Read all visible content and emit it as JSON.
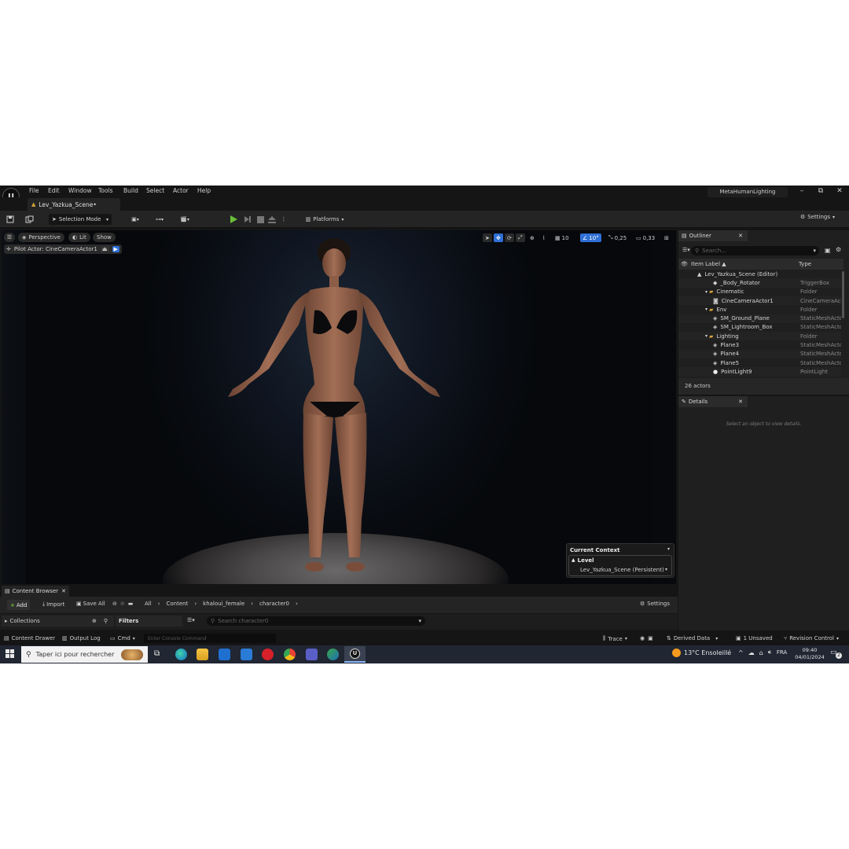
{
  "menu": {
    "logo": "U",
    "items": [
      "File",
      "Edit",
      "Window",
      "Tools",
      "Build",
      "Select",
      "Actor",
      "Help"
    ],
    "project": "MetaHumanLighting"
  },
  "window_controls": {
    "minimize": "–",
    "restore": "⧉",
    "close": "✕"
  },
  "level_tab": {
    "label": "Lev_Yazkua_Scene•"
  },
  "toolbar": {
    "selection_mode": "Selection Mode",
    "platforms": "Platforms",
    "settings": "Settings",
    "colors": {
      "play": "#6abf3a"
    }
  },
  "viewport": {
    "perspective": "Perspective",
    "lit": "Lit",
    "show": "Show",
    "pilot_actor": "Pilot Actor: CineCameraActor1",
    "grid_snap": "10",
    "angle_snap": "10°",
    "scale_snap": "0,25",
    "camera_speed": "0,33",
    "context": {
      "title": "Current Context",
      "level_label": "Level",
      "level_value": "Lev_Yazkua_Scene (Persistent)"
    }
  },
  "outliner": {
    "tab": "Outliner",
    "search_placeholder": "Search...",
    "col_label": "Item Label ▲",
    "col_type": "Type",
    "rows": [
      {
        "label": "Lev_Yazkua_Scene (Editor)",
        "type": "",
        "indent": 0,
        "kind": "level"
      },
      {
        "label": "_Body_Rotator",
        "type": "TriggerBox",
        "indent": 2,
        "kind": "actor"
      },
      {
        "label": "Cinematic",
        "type": "Folder",
        "indent": 1,
        "kind": "folder"
      },
      {
        "label": "CineCameraActor1",
        "type": "CineCameraActor",
        "indent": 2,
        "kind": "camera"
      },
      {
        "label": "Env",
        "type": "Folder",
        "indent": 1,
        "kind": "folder"
      },
      {
        "label": "SM_Ground_Plane",
        "type": "StaticMeshActor",
        "indent": 2,
        "kind": "mesh"
      },
      {
        "label": "SM_Lightroom_Box",
        "type": "StaticMeshActor",
        "indent": 2,
        "kind": "mesh"
      },
      {
        "label": "Lighting",
        "type": "Folder",
        "indent": 1,
        "kind": "folder"
      },
      {
        "label": "Plane3",
        "type": "StaticMeshActor",
        "indent": 2,
        "kind": "mesh"
      },
      {
        "label": "Plane4",
        "type": "StaticMeshActor",
        "indent": 2,
        "kind": "mesh"
      },
      {
        "label": "Plane5",
        "type": "StaticMeshActor",
        "indent": 2,
        "kind": "mesh"
      },
      {
        "label": "PointLight9",
        "type": "PointLight",
        "indent": 2,
        "kind": "light"
      }
    ],
    "count": "26 actors"
  },
  "details": {
    "tab": "Details",
    "empty": "Select an object to view details."
  },
  "content_browser": {
    "tab": "Content Browser",
    "add": "Add",
    "import": "Import",
    "save_all": "Save All",
    "breadcrumb": [
      "All",
      "Content",
      "khaloui_female",
      "character0"
    ],
    "settings": "Settings",
    "favorites": "Collections",
    "filters": "Filters",
    "search_placeholder": "Search character0"
  },
  "statusbar": {
    "content_drawer": "Content Drawer",
    "output_log": "Output Log",
    "cmd": "Cmd",
    "console_placeholder": "Enter Console Command",
    "trace": "Trace",
    "derived_data": "Derived Data",
    "unsaved": "1 Unsaved",
    "revision": "Revision Control"
  },
  "taskbar": {
    "search": "Taper ici pour rechercher",
    "weather": "13°C  Ensoleillé",
    "lang": "FRA",
    "time": "09:40",
    "date": "04/01/2024",
    "notifications": "2"
  }
}
